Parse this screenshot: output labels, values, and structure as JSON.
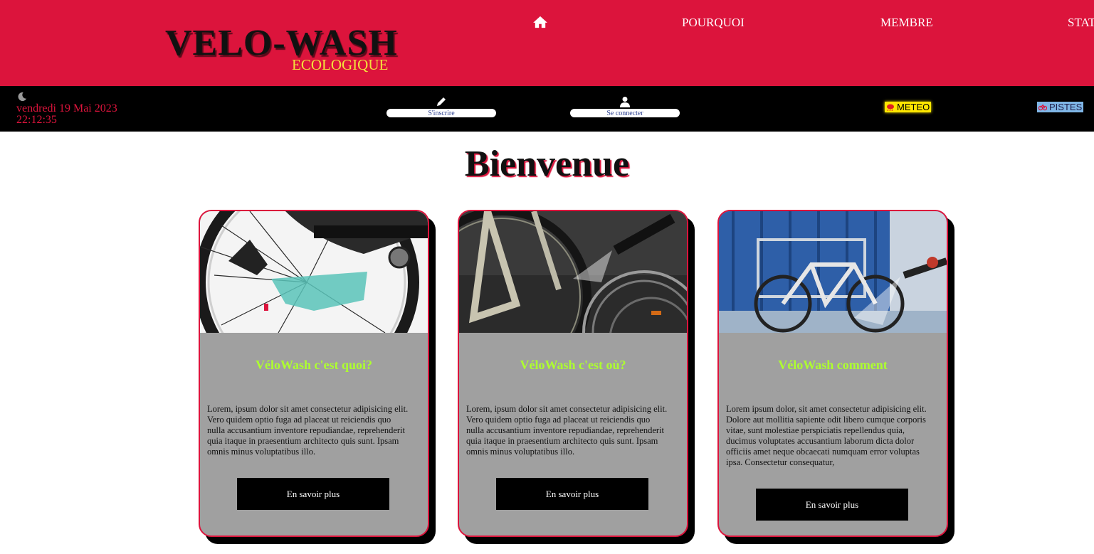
{
  "header": {
    "logo": "VELO-WASH",
    "logo_sub": "ECOLOGIQUE",
    "nav": [
      {
        "label": "POURQUOI"
      },
      {
        "label": "MEMBRE"
      },
      {
        "label": "STAT"
      }
    ],
    "bg_color": "#dc143c"
  },
  "topbar": {
    "date": "vendredi 19 Mai 2023",
    "time": "22:12:35",
    "signup_label": "S'inscrire",
    "login_label": "Se connecter",
    "meteo_label": "METEO",
    "pistes_label": "PISTES"
  },
  "main": {
    "title": "Bienvenue",
    "cards": [
      {
        "title": "VéloWash c'est quoi?",
        "text": "Lorem, ipsum dolor sit amet consectetur adipisicing elit. Vero quidem optio fuga ad placeat ut reiciendis quo nulla accusantium inventore repudiandae, reprehenderit quia itaque in praesentium architecto quis sunt. Ipsam omnis minus voluptatibus illo.",
        "button": "En savoir plus"
      },
      {
        "title": "VéloWash c'est où?",
        "text": "Lorem, ipsum dolor sit amet consectetur adipisicing elit. Vero quidem optio fuga ad placeat ut reiciendis quo nulla accusantium inventore repudiandae, reprehenderit quia itaque in praesentium architecto quis sunt. Ipsam omnis minus voluptatibus illo.",
        "button": "En savoir plus"
      },
      {
        "title": "VéloWash comment",
        "text": "Lorem ipsum dolor, sit amet consectetur adipisicing elit. Dolore aut mollitia sapiente odit libero cumque corporis vitae, sunt molestiae perspiciatis repellendus quia, ducimus voluptates accusantium laborum dicta dolor officiis amet neque obcaecati numquam error voluptas ipsa. Consectetur consequatur,",
        "button": "En savoir plus"
      }
    ]
  },
  "colors": {
    "accent": "#dc143c",
    "card_title": "#adff2f",
    "logo_sub": "#f2e13c",
    "card_bg": "#a0a0a0"
  },
  "icons": [
    "home-icon",
    "moon-icon",
    "pencil-icon",
    "user-icon",
    "weather-icon",
    "bike-icon"
  ]
}
